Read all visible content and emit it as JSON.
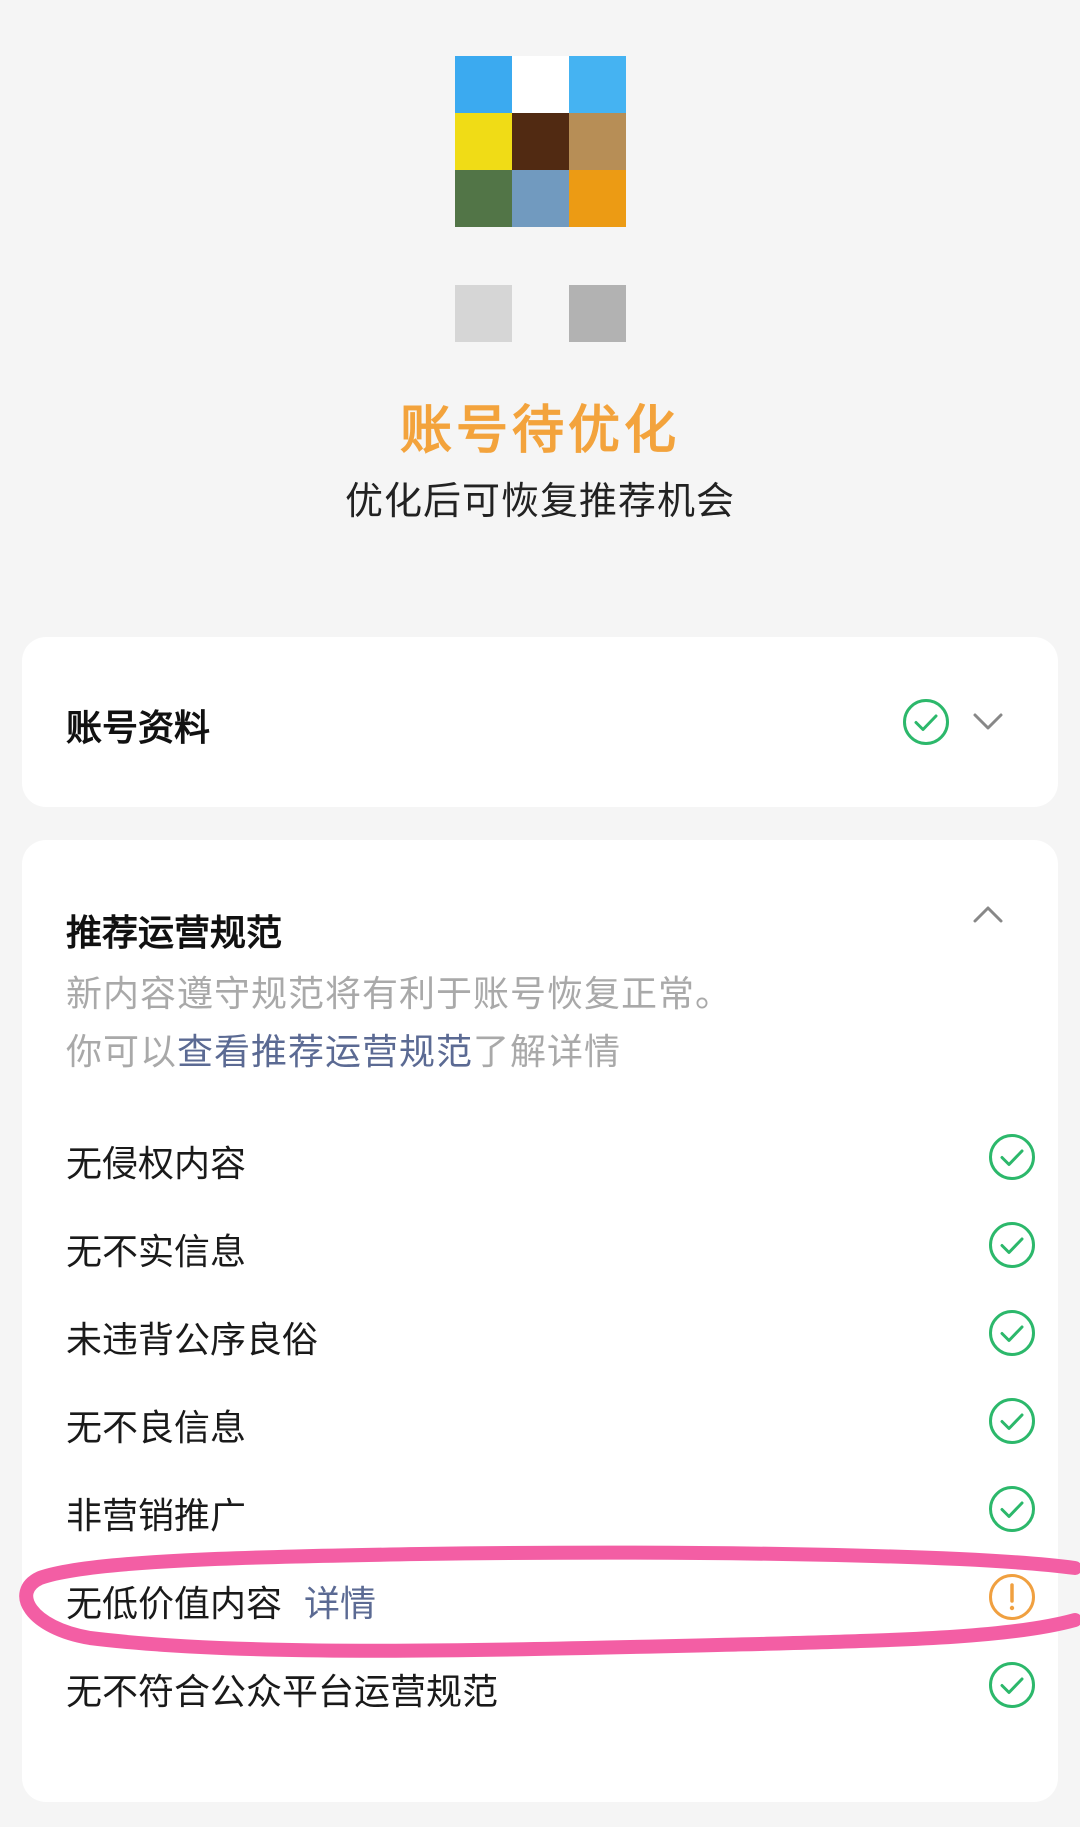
{
  "header": {
    "status_title": "账号待优化",
    "status_subtitle": "优化后可恢复推荐机会"
  },
  "colors": {
    "accent_orange": "#f3a33c",
    "ok_green": "#2cb86b",
    "warn_orange": "#f0a040",
    "link_blue": "#5b6a93",
    "highlight_pink": "#f2559f"
  },
  "account_info": {
    "title": "账号资料",
    "status_icon": "check-circle-icon",
    "toggle_icon": "chevron-down-icon"
  },
  "rules": {
    "title": "推荐运营规范",
    "toggle_icon": "chevron-up-icon",
    "desc_line1": "新内容遵守规范将有利于账号恢复正常。",
    "desc_line2_prefix": "你可以",
    "desc_line2_link": "查看推荐运营规范",
    "desc_line2_suffix": "了解详情",
    "items": [
      {
        "label": "无侵权内容",
        "status": "ok"
      },
      {
        "label": "无不实信息",
        "status": "ok"
      },
      {
        "label": "未违背公序良俗",
        "status": "ok"
      },
      {
        "label": "无不良信息",
        "status": "ok"
      },
      {
        "label": "非营销推广",
        "status": "ok"
      },
      {
        "label": "无低价值内容",
        "status": "warn",
        "detail": "详情"
      },
      {
        "label": "无不符合公众平台运营规范",
        "status": "ok"
      }
    ]
  }
}
